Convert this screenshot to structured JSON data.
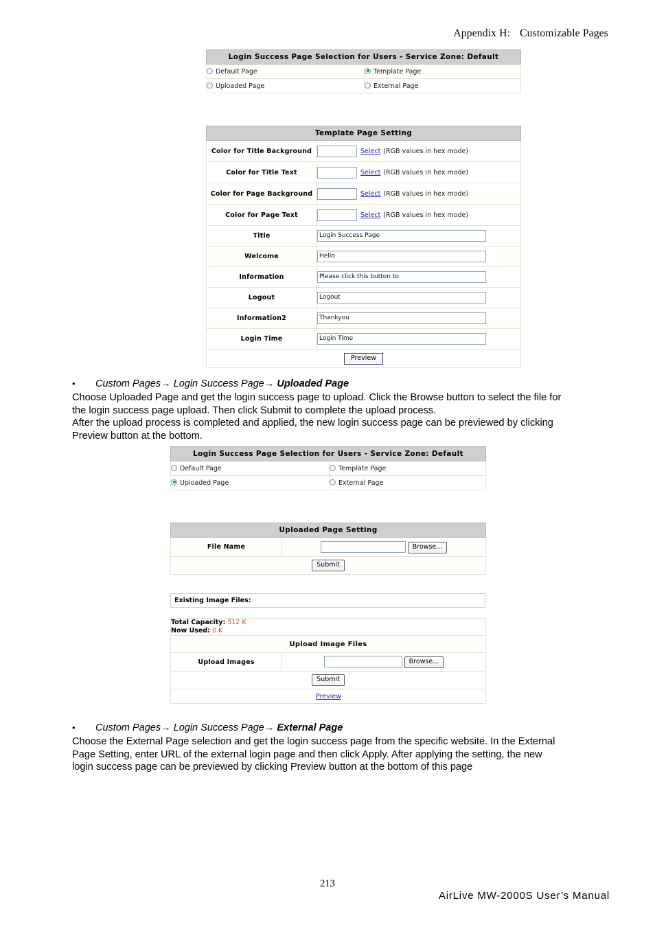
{
  "header": {
    "appendix": "Appendix H:",
    "title": "Customizable Pages"
  },
  "selection_panel_1": {
    "title": "Login Success Page Selection for Users - Service Zone: Default",
    "options": [
      {
        "label": "Default Page",
        "selected": false
      },
      {
        "label": "Template Page",
        "selected": true
      },
      {
        "label": "Uploaded Page",
        "selected": false
      },
      {
        "label": "External Page",
        "selected": false
      }
    ]
  },
  "template_page_setting": {
    "title": "Template Page Setting",
    "color_rows": [
      {
        "label": "Color for Title Background",
        "value": "",
        "link": "Select",
        "hint": "(RGB values in hex mode)"
      },
      {
        "label": "Color for Title Text",
        "value": "",
        "link": "Select",
        "hint": "(RGB values in hex mode)"
      },
      {
        "label": "Color for Page Background",
        "value": "",
        "link": "Select",
        "hint": "(RGB values in hex mode)"
      },
      {
        "label": "Color for Page Text",
        "value": "",
        "link": "Select",
        "hint": "(RGB values in hex mode)"
      }
    ],
    "text_rows": [
      {
        "label": "Title",
        "value": "Login Success Page"
      },
      {
        "label": "Welcome",
        "value": "Hello"
      },
      {
        "label": "Information",
        "value": "Please click this button to"
      },
      {
        "label": "Logout",
        "value": "Logout"
      },
      {
        "label": "Information2",
        "value": "Thankyou"
      },
      {
        "label": "Login Time",
        "value": "Login Time"
      }
    ],
    "preview_button": "Preview"
  },
  "section_uploaded": {
    "bullet": {
      "dot": "•",
      "part1": "Custom Pages",
      "arrow1": "→",
      "part2": "Login Success Page",
      "arrow2": "→",
      "part3": "Uploaded Page"
    },
    "paragraph_line1": "Choose Uploaded Page and get the login success page to upload. Click the Browse button to select the file for",
    "paragraph_line2": "the login success page upload. Then click Submit to complete the upload process.",
    "paragraph_line3": "After the upload process is completed and applied, the new login success page can be previewed by clicking",
    "paragraph_line4": "Preview button at the bottom."
  },
  "selection_panel_2": {
    "title": "Login Success Page Selection for Users - Service Zone: Default",
    "options": [
      {
        "label": "Default Page",
        "selected": false
      },
      {
        "label": "Template Page",
        "selected": false
      },
      {
        "label": "Uploaded Page",
        "selected": true
      },
      {
        "label": "External Page",
        "selected": false
      }
    ]
  },
  "uploaded_page_setting": {
    "title": "Uploaded Page Setting",
    "file_name_label": "File Name",
    "file_name_value": "",
    "browse_button": "Browse...",
    "submit_button": "Submit"
  },
  "existing_image_files": {
    "label": "Existing Image Files:"
  },
  "capacity": {
    "total_label": "Total Capacity:",
    "total_value": "512 K",
    "used_label": "Now Used:",
    "used_value": "0 K",
    "accent_color": "#e23b30"
  },
  "upload_image_files": {
    "title": "Upload Image Files",
    "upload_label": "Upload Images",
    "upload_value": "",
    "browse_button": "Browse...",
    "submit_button": "Submit",
    "preview_link": "Preview"
  },
  "section_external": {
    "bullet": {
      "dot": "•",
      "part1": "Custom Pages",
      "arrow1": "→",
      "part2": "Login Success Page",
      "arrow2": "→",
      "part3": "External Page"
    },
    "paragraph_line1": "Choose the External Page selection and get the login success page from the specific website. In the External",
    "paragraph_line2": "Page Setting, enter URL of the external login page and then click Apply. After applying the setting, the new",
    "paragraph_line3": "login success page can be previewed by clicking Preview button at the bottom of this page"
  },
  "footer": {
    "page_number": "213",
    "manual": "AirLive MW-2000S User’s Manual"
  }
}
